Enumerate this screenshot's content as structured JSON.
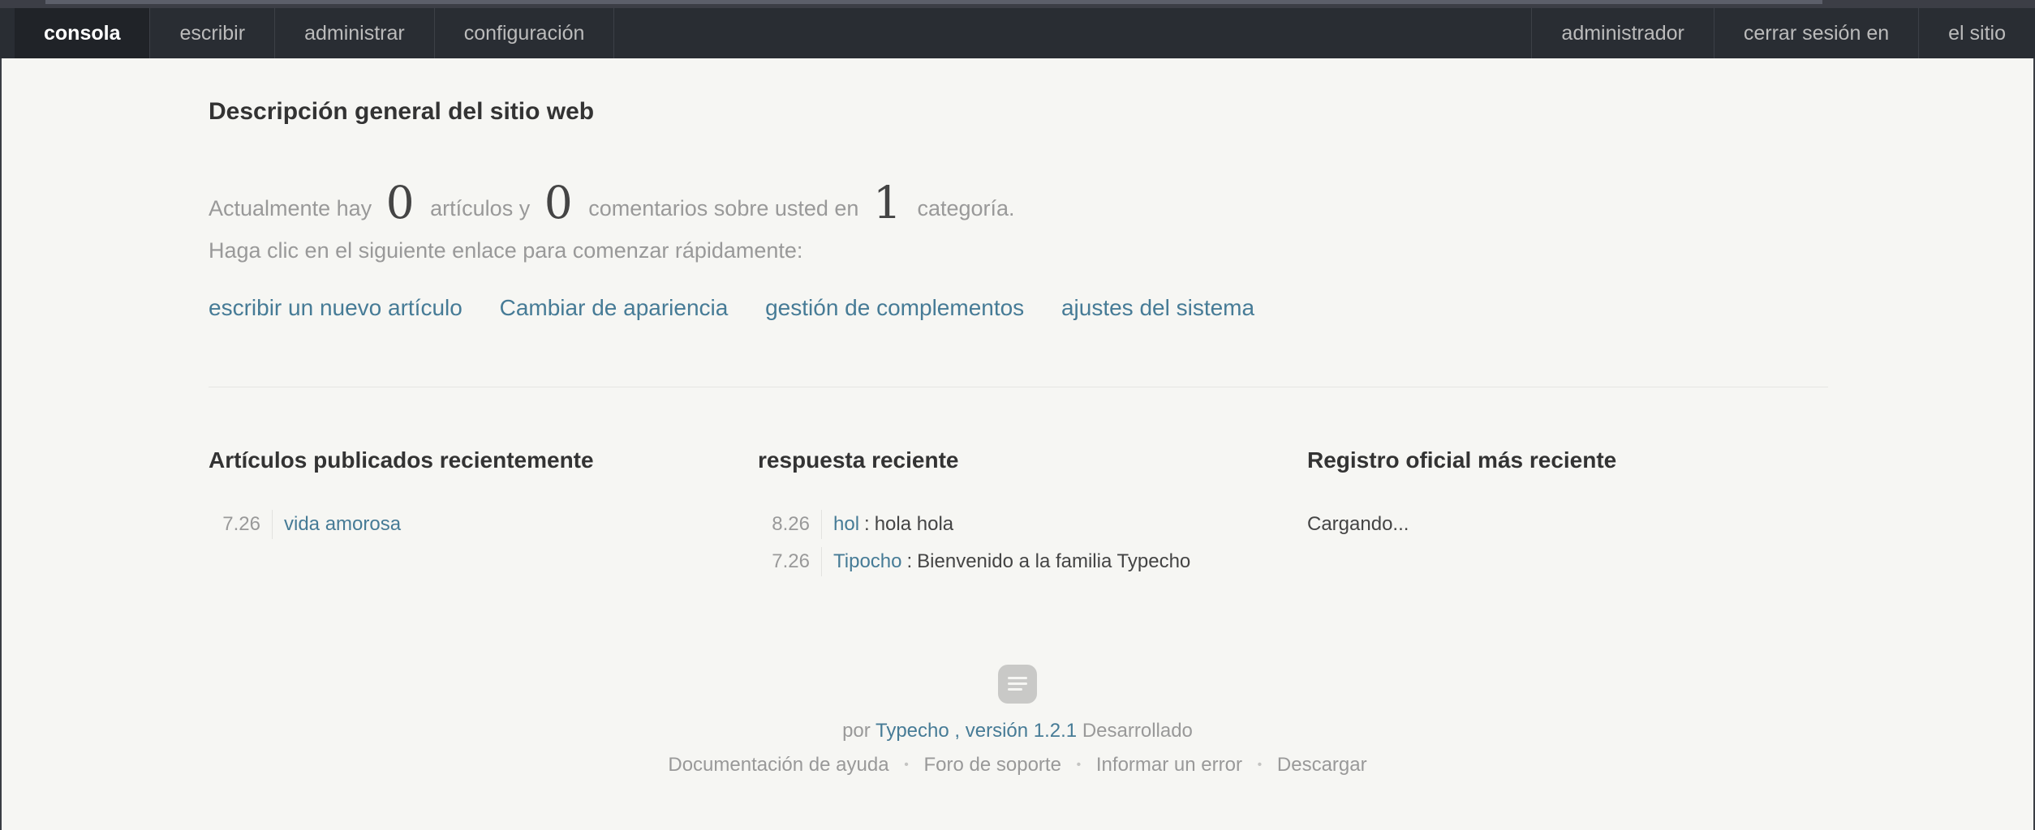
{
  "nav": {
    "left": [
      "consola",
      "escribir",
      "administrar",
      "configuración"
    ],
    "right": [
      "administrador",
      "cerrar sesión en",
      "el sitio"
    ]
  },
  "overview": {
    "title": "Descripción general del sitio web",
    "stats_prefix": "Actualmente hay",
    "articles_count": "0",
    "articles_label": "artículos y",
    "comments_count": "0",
    "comments_label": "comentarios sobre usted en",
    "categories_count": "1",
    "categories_label": "categoría.",
    "quick_hint": "Haga clic en el siguiente enlace para comenzar rápidamente:",
    "quick_links": [
      "escribir un nuevo artículo",
      "Cambiar de apariencia",
      "gestión de complementos",
      "ajustes del sistema"
    ]
  },
  "recent_posts": {
    "title": "Artículos publicados recientemente",
    "items": [
      {
        "date": "7.26",
        "title": "vida amorosa"
      }
    ]
  },
  "recent_replies": {
    "title": "respuesta reciente",
    "items": [
      {
        "date": "8.26",
        "author": "hol",
        "separator": ":",
        "text": "hola hola"
      },
      {
        "date": "7.26",
        "author": "Tipocho",
        "separator": ":",
        "text": "Bienvenido a la familia Typecho"
      }
    ]
  },
  "official_log": {
    "title": "Registro oficial más reciente",
    "loading": "Cargando..."
  },
  "footer": {
    "logo_icon": "typecho-logo-icon",
    "by": "por",
    "product": "Typecho",
    "version": ", versión 1.2.1",
    "developed": "Desarrollado",
    "links": [
      "Documentación de ayuda",
      "Foro de soporte",
      "Informar un error",
      "Descargar"
    ]
  },
  "colors": {
    "navbar": "#292d33",
    "background": "#f6f6f3",
    "link": "#467b96"
  }
}
